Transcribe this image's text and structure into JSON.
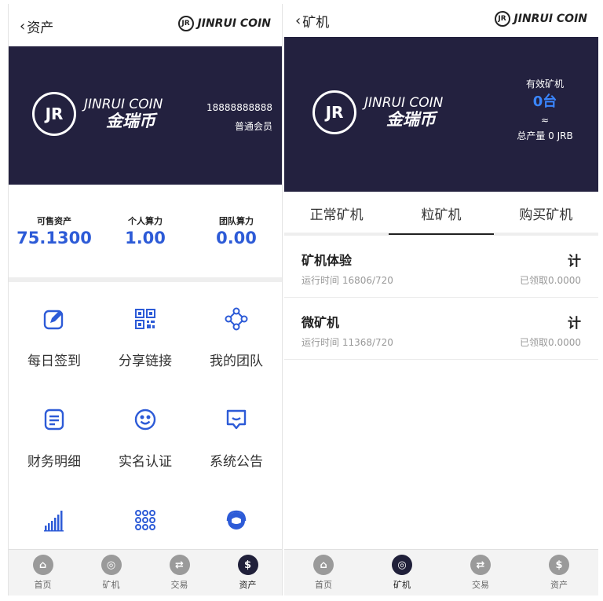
{
  "left": {
    "header": {
      "back_label": "资产",
      "brand_text": "JINRUI COIN",
      "brand_mark": "JR"
    },
    "banner": {
      "logo_mark": "JR",
      "logo_en": "JINRUI COIN",
      "logo_cn": "金瑞币",
      "phone": "18888888888",
      "member_level": "普通会员"
    },
    "stats": [
      {
        "label": "可售资产",
        "value": "75.1300"
      },
      {
        "label": "个人算力",
        "value": "1.00"
      },
      {
        "label": "团队算力",
        "value": "0.00"
      }
    ],
    "menu": [
      {
        "label": "每日签到",
        "icon": "edit-icon"
      },
      {
        "label": "分享链接",
        "icon": "qr-code-icon"
      },
      {
        "label": "我的团队",
        "icon": "team-network-icon"
      },
      {
        "label": "财务明细",
        "icon": "document-list-icon"
      },
      {
        "label": "实名认证",
        "icon": "smiley-face-icon"
      },
      {
        "label": "系统公告",
        "icon": "message-box-icon"
      },
      {
        "label": "",
        "icon": "bar-chart-icon"
      },
      {
        "label": "",
        "icon": "grid-dots-icon"
      },
      {
        "label": "",
        "icon": "headset-support-icon"
      }
    ],
    "tabbar": [
      {
        "label": "首页",
        "icon": "home-icon",
        "active": false
      },
      {
        "label": "矿机",
        "icon": "miner-icon",
        "active": false
      },
      {
        "label": "交易",
        "icon": "exchange-icon",
        "active": false
      },
      {
        "label": "资产",
        "icon": "dollar-icon",
        "glyph": "$",
        "active": true
      }
    ]
  },
  "right": {
    "header": {
      "back_label": "矿机",
      "brand_text": "JINRUI COIN",
      "brand_mark": "JR"
    },
    "banner": {
      "logo_mark": "JR",
      "logo_en": "JINRUI COIN",
      "logo_cn": "金瑞币",
      "valid_label": "有效矿机",
      "valid_value": "0台",
      "approx": "≈",
      "total_output": "总产量 0 JRB"
    },
    "tabs": [
      {
        "label": "正常矿机",
        "active": false
      },
      {
        "label": "粒矿机",
        "active": true
      },
      {
        "label": "购买矿机",
        "active": false
      }
    ],
    "machines": [
      {
        "name": "矿机体验",
        "runtime": "运行时间 16806/720",
        "calc": "计",
        "received": "已领取0.0000"
      },
      {
        "name": "微矿机",
        "runtime": "运行时间 11368/720",
        "calc": "计",
        "received": "已领取0.0000"
      }
    ],
    "tabbar": [
      {
        "label": "首页",
        "icon": "home-icon",
        "active": false
      },
      {
        "label": "矿机",
        "icon": "miner-icon",
        "active": true
      },
      {
        "label": "交易",
        "icon": "exchange-icon",
        "active": false
      },
      {
        "label": "资产",
        "icon": "dollar-icon",
        "glyph": "$",
        "active": false
      }
    ]
  },
  "colors": {
    "banner": "#23213f",
    "accent": "#2d5bd7",
    "highlight": "#3a86ff"
  }
}
